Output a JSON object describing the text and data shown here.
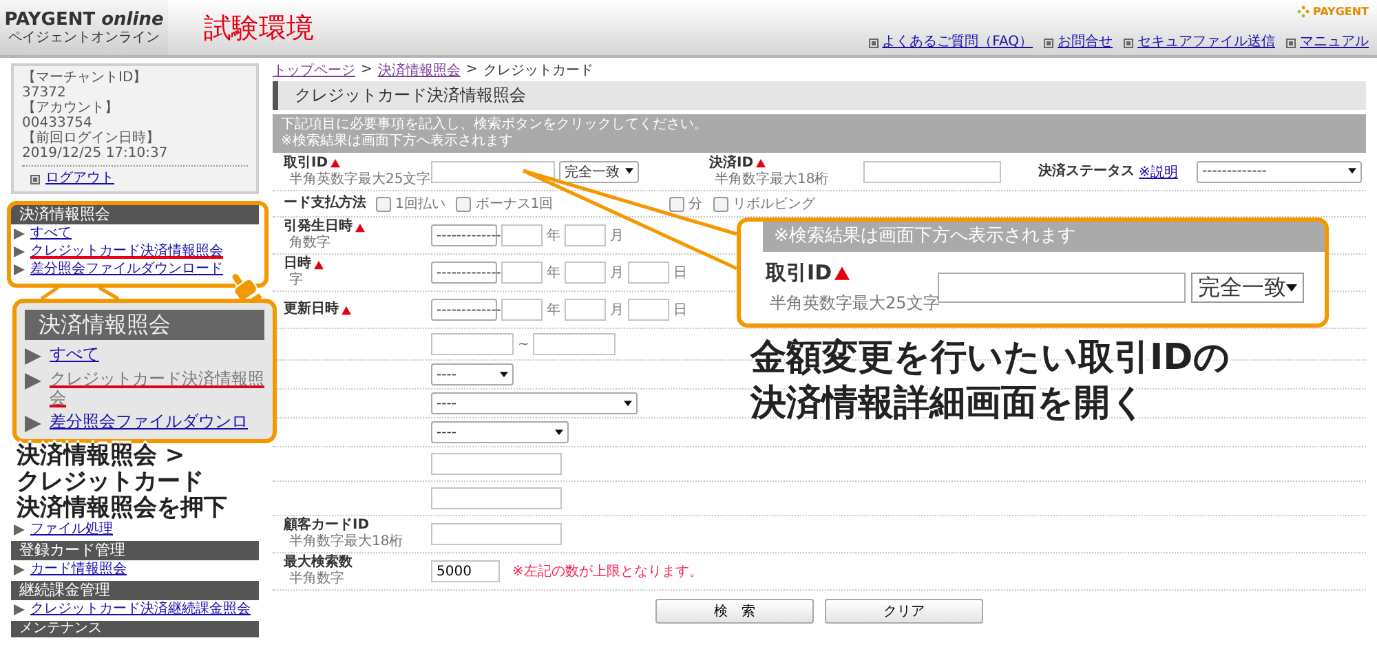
{
  "header": {
    "logo": "PAYGENT *online*",
    "logo_sub": "ペイジェントオンライン",
    "environment": "試験環境",
    "brand": "PAYGENT",
    "links": [
      "よくあるご質問（FAQ）",
      "お問合せ",
      "セキュアファイル送信",
      "マニュアル"
    ]
  },
  "sidebar": {
    "account_lines": [
      "【マーチャントID】",
      "37372",
      "【アカウント】",
      "00433754",
      "【前回ログイン日時】",
      "2019/12/25 17:10:37"
    ],
    "logout": "ログアウト",
    "sections": [
      {
        "title": "決済情報照会",
        "links": [
          {
            "label": "すべて",
            "highlighted": false
          },
          {
            "label": "クレジットカード決済情報照会",
            "highlighted": true
          },
          {
            "label": "差分照会ファイルダウンロード",
            "highlighted": false
          }
        ]
      }
    ],
    "lower_sections": [
      {
        "links": [
          {
            "label": "ファイル処理"
          }
        ]
      },
      {
        "title": "登録カード管理",
        "links": [
          {
            "label": "カード情報照会"
          }
        ]
      },
      {
        "title": "継続課金管理",
        "links": [
          {
            "label": "クレジットカード決済継続課金照会"
          }
        ]
      },
      {
        "title": "メンテナンス"
      }
    ]
  },
  "main": {
    "breadcrumb": [
      {
        "label": "トップページ",
        "kind": "link"
      },
      {
        "label": "決済情報照会",
        "kind": "link"
      },
      {
        "label": "クレジットカード",
        "kind": "current"
      }
    ],
    "breadcrumb_separator": ">",
    "title": "クレジットカード決済情報照会",
    "notice": [
      "下記項目に必要事項を記入し、検索ボタンをクリックしてください。",
      "※検索結果は画面下方へ表示されます"
    ],
    "form": {
      "rows": [
        {
          "kind": "id",
          "label": "取引ID",
          "required": true,
          "hint": "半角英数字最大25文字",
          "match": "完全一致",
          "second_label": "決済ID",
          "second_required": true,
          "second_hint": "半角数字最大18桁",
          "status_label": "決済ステータス",
          "status_help": "※説明",
          "status_value": "-------------"
        },
        {
          "kind": "checks",
          "label": "ード支払方法",
          "options": [
            {
              "label": "1回払い",
              "checked": false
            },
            {
              "label": "ボーナス1回",
              "checked": false
            },
            {
              "label": "分",
              "checked": false
            },
            {
              "label": "リボルビング",
              "checked": false
            }
          ]
        },
        {
          "kind": "date",
          "label": "引発生日時",
          "required": true,
          "hint": "角数字",
          "select": "-------------",
          "units": [
            "年",
            "月"
          ]
        },
        {
          "kind": "date",
          "label": "日時",
          "required": true,
          "hint": "字",
          "select": "-------------",
          "units": [
            "年",
            "月",
            "日"
          ]
        },
        {
          "kind": "date",
          "label": "更新日時",
          "required": true,
          "select": "-------------",
          "units": [
            "年",
            "月",
            "日"
          ]
        },
        {
          "kind": "range",
          "separator": "~"
        },
        {
          "kind": "select",
          "value": "----"
        },
        {
          "kind": "select",
          "value": "----"
        },
        {
          "kind": "select",
          "value": "----"
        },
        {
          "kind": "text"
        },
        {
          "kind": "text"
        },
        {
          "kind": "text",
          "label": "顧客カードID",
          "hint": "半角数字最大18桁"
        },
        {
          "kind": "text",
          "label": "最大検索数",
          "hint": "半角数字",
          "value": "5000",
          "note": "※左記の数が上限となります。"
        }
      ]
    },
    "buttons": [
      "検　索",
      "クリア"
    ]
  },
  "annotations": {
    "menu_callout": {
      "title": "決済情報照会",
      "items": [
        {
          "label": "すべて",
          "highlighted": false
        },
        {
          "label": "クレジットカード決済情報照会",
          "highlighted": true
        },
        {
          "label": "差分照会ファイルダウンロ",
          "highlighted": false
        }
      ]
    },
    "menu_caption": [
      "決済情報照会 >",
      "クレジットカード",
      "決済情報照会を押下"
    ],
    "field_callout": {
      "notice": "※検索結果は画面下方へ表示されます",
      "label": "取引ID",
      "required": true,
      "hint": "半角英数字最大25文字",
      "match": "完全一致"
    },
    "field_caption": [
      "金額変更を行いたい取引IDの",
      "決済情報詳細画面を開く"
    ]
  }
}
